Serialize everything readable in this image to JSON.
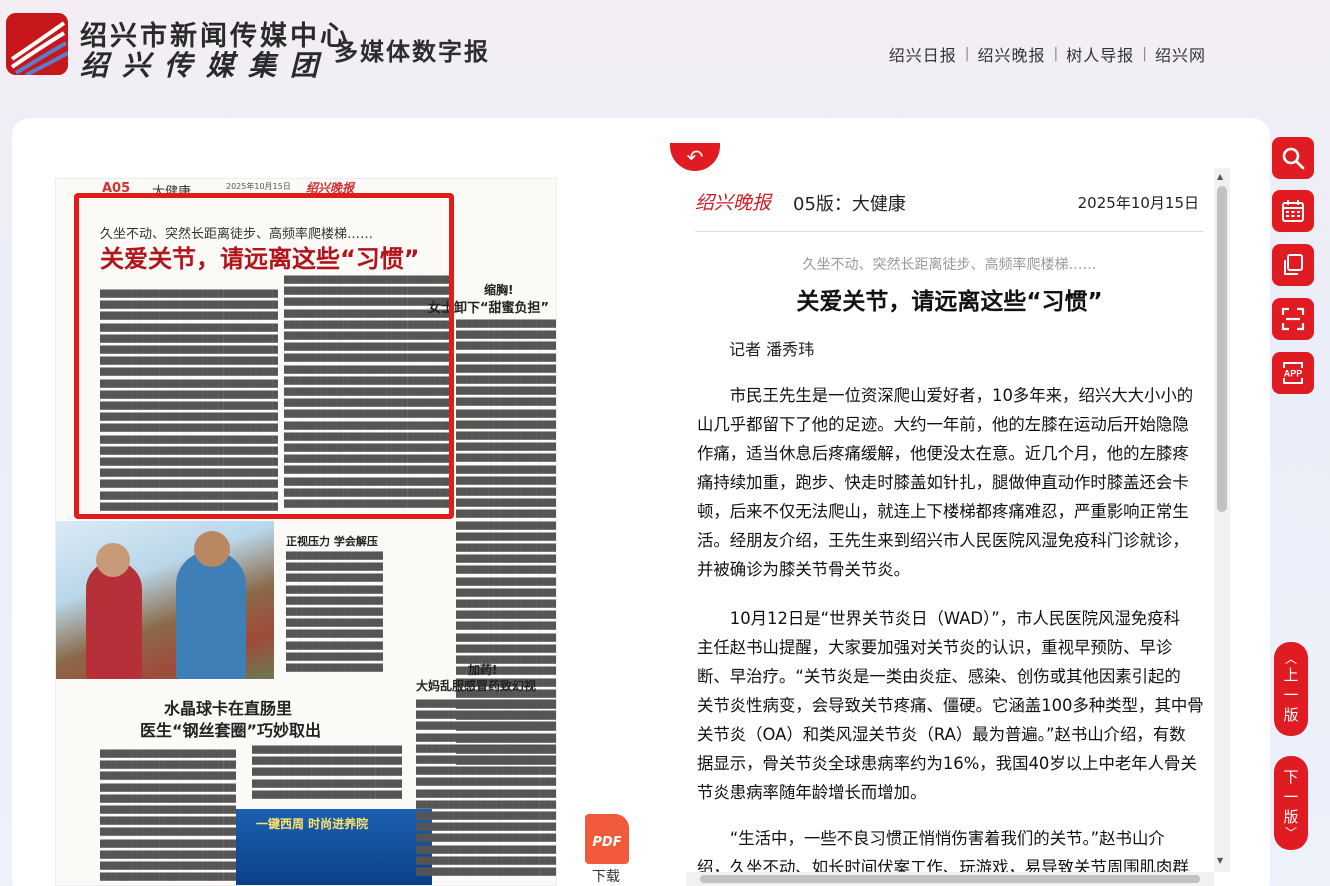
{
  "header": {
    "org_name": "绍兴市新闻传媒中心",
    "group_name": "绍兴传媒集团",
    "site_title": "多媒体数字报",
    "links": [
      "绍兴日报",
      "绍兴晚报",
      "树人导报",
      "绍兴网"
    ]
  },
  "newspaper": {
    "page_mark": "A05",
    "section": "大健康",
    "masthead_date": "2025年10月15日",
    "brand": "绍兴晚报",
    "lead_sub": "久坐不动、突然长距离徒步、高频率爬楼梯……",
    "lead_title": "关爱关节，请远离这些“习惯”",
    "story2_title_a": "缩胸!",
    "story2_title_b": "女士卸下“甜蜜负担”",
    "story3_title": "正视压力 学会解压",
    "story4_title_a": "水晶球卡在直肠里",
    "story4_title_b": "医生“钢丝套圈”巧妙取出",
    "story5_title_a": "加药!",
    "story5_title_b": "大妈乱服感冒药致幻视",
    "ad_text": "一键西周 时尚进养院"
  },
  "article": {
    "brand": "绍兴晚报",
    "page_label": "05版：大健康",
    "date": "2025年10月15日",
    "subtitle": "久坐不动、突然长距离徒步、高频率爬楼梯……",
    "title": "关爱关节，请远离这些“习惯”",
    "author": "记者 潘秀玮",
    "paragraphs": [
      [
        "　　市民王先生是一位资深爬山爱好者，10多年来，绍兴大大小小的",
        "山几乎都留下了他的足迹。大约一年前，他的左膝在运动后开始隐隐",
        "作痛，适当休息后疼痛缓解，他便没太在意。近几个月，他的左膝疼",
        "痛持续加重，跑步、快走时膝盖如针扎，腿做伸直动作时膝盖还会卡",
        "顿，后来不仅无法爬山，就连上下楼梯都疼痛难忍，严重影响正常生",
        "活。经朋友介绍，王先生来到绍兴市人民医院风湿免疫科门诊就诊，",
        "并被确诊为膝关节骨关节炎。"
      ],
      [
        "　　10月12日是“世界关节炎日（WAD）”，市人民医院风湿免疫科",
        "主任赵书山提醒，大家要加强对关节炎的认识，重视早预防、早诊",
        "断、早治疗。“关节炎是一类由炎症、感染、创伤或其他因素引起的",
        "关节炎性病变，会导致关节疼痛、僵硬。它涵盖100多种类型，其中骨",
        "关节炎（OA）和类风湿关节炎（RA）最为普遍。”赵书山介绍，有数",
        "据显示，骨关节炎全球患病率约为16%，我国40岁以上中老年人骨关",
        "节炎患病率随年龄增长而增加。"
      ],
      [
        "　　“生活中，一些不良习惯正悄悄伤害着我们的关节。”赵书山介",
        "绍，久坐不动、如长时间伏案工作、玩游戏，易导致关节周围肌肉群"
      ]
    ]
  },
  "tools": {
    "pdf_label": "PDF",
    "download_label": "下载",
    "prev_page": [
      "上",
      "一",
      "版"
    ],
    "next_page": [
      "下",
      "一",
      "版"
    ],
    "app_label": "APP",
    "icons": [
      "search-icon",
      "calendar-icon",
      "copy-icon",
      "scan-icon",
      "app-icon"
    ]
  },
  "colors": {
    "accent": "#e01b22",
    "highlight": "#e21b1b"
  }
}
